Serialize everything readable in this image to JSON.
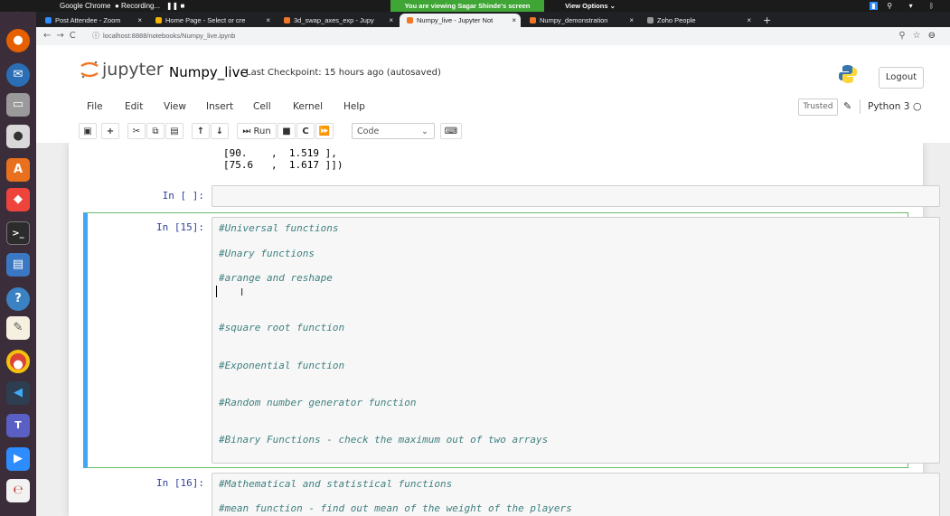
{
  "topbar": {
    "chrome_label": "Google Chrome",
    "recording_label": "Recording...",
    "share_banner": "You are viewing Sagar Shinde's screen",
    "view_options": "View Options ⌄"
  },
  "tabs": [
    {
      "title": "Post Attendee - Zoom",
      "favicon_color": "#2d8cff",
      "active": false
    },
    {
      "title": "Home Page - Select or cre",
      "favicon_color": "#f4b400",
      "active": false
    },
    {
      "title": "3d_swap_axes_exp - Jupy",
      "favicon_color": "#f37626",
      "active": false
    },
    {
      "title": "Numpy_live - Jupyter Not",
      "favicon_color": "#f37626",
      "active": true
    },
    {
      "title": "Numpy_demonstration",
      "favicon_color": "#f37626",
      "active": false
    },
    {
      "title": "Zoho People",
      "favicon_color": "#999999",
      "active": false
    }
  ],
  "urlbar": {
    "url": "localhost:8888/notebooks/Numpy_live.ipynb"
  },
  "jupyter": {
    "logo_text": "jupyter",
    "notebook_name": "Numpy_live",
    "checkpoint": "Last Checkpoint: 15 hours ago  (autosaved)",
    "logout": "Logout",
    "menu": [
      "File",
      "Edit",
      "View",
      "Insert",
      "Cell",
      "Kernel",
      "Help"
    ],
    "trusted": "Trusted",
    "kernel": "Python 3",
    "toolbar": {
      "run_label": "Run",
      "cell_type": "Code"
    }
  },
  "cells": {
    "output_lines": [
      "[90.    ,  1.519 ],",
      "[75.6   ,  1.617 ]])"
    ],
    "empty_prompt": "In [ ]:",
    "cell15": {
      "prompt": "In [15]:",
      "lines": [
        "#Universal functions",
        "#Unary functions",
        "#arange and reshape",
        "#square root function",
        "#Exponential function",
        "#Random number generator function",
        "#Binary Functions - check the maximum out of two arrays"
      ]
    },
    "cell16": {
      "prompt": "In [16]:",
      "lines": [
        "#Mathematical and statistical functions",
        "#mean function - find out mean of the weight of the players"
      ]
    }
  },
  "colors": {
    "comment": "#408080",
    "prompt": "#303f9f",
    "selected_border": "#66bb6a",
    "selected_bar": "#42a5f5"
  }
}
